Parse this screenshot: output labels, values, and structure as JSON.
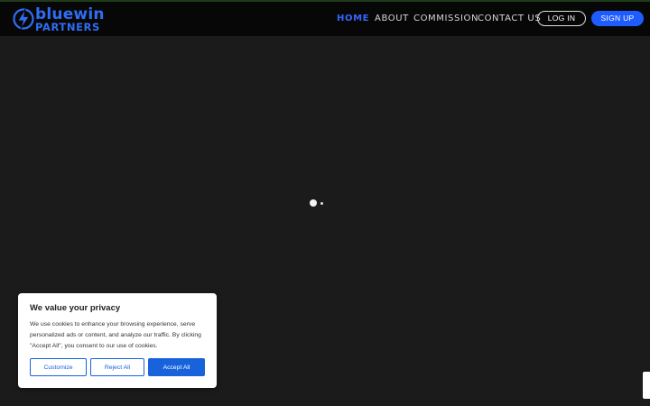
{
  "brand": {
    "name_line1": "bluewin",
    "name_line2": "PARTNERS",
    "icon": "lightning-bolt-icon",
    "color": "#2f6df5"
  },
  "nav": {
    "items": [
      {
        "label": "HOME",
        "active": true
      },
      {
        "label": "ABOUT",
        "active": false
      },
      {
        "label": "COMMISSION",
        "active": false
      },
      {
        "label": "CONTACT US",
        "active": false
      }
    ],
    "login_label": "LOG IN",
    "signup_label": "SIGN UP"
  },
  "cookie_banner": {
    "title": "We value your privacy",
    "text": "We use cookies to enhance your browsing experience, serve personalized ads or content, and analyze our traffic. By clicking \"Accept All\", you consent to our use of cookies.",
    "customize_label": "Customize",
    "reject_label": "Reject All",
    "accept_label": "Accept All"
  },
  "colors": {
    "accent": "#1f5cff",
    "cookie_accent": "#1863dc",
    "background": "#1b1b1b",
    "header": "#070707"
  }
}
